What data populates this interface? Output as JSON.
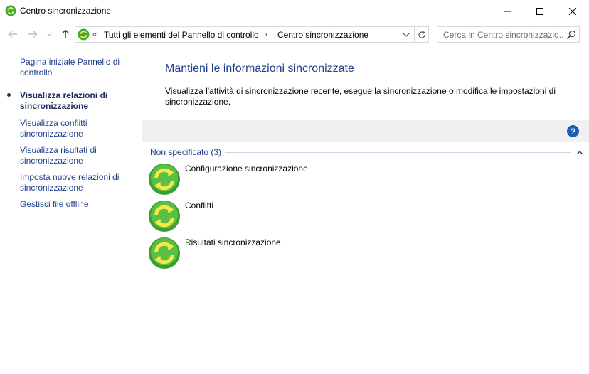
{
  "window": {
    "title": "Centro sincronizzazione",
    "minimize_icon": "minimize-icon",
    "maximize_icon": "maximize-icon",
    "close_icon": "close-icon"
  },
  "navigation": {
    "address_chevron": "«",
    "breadcrumbs": [
      "Tutti gli elementi del Pannello di controllo",
      "Centro sincronizzazione"
    ],
    "breadcrumb_separator": "›",
    "search": {
      "placeholder": "Cerca in Centro sincronizzazio..."
    }
  },
  "sidebar": {
    "items": [
      {
        "label": "Pagina iniziale Pannello di controllo",
        "active": false
      },
      {
        "label": "Visualizza relazioni di sincronizzazione",
        "active": true
      },
      {
        "label": "Visualizza conflitti sincronizzazione",
        "active": false
      },
      {
        "label": "Visualizza risultati di sincronizzazione",
        "active": false
      },
      {
        "label": "Imposta nuove relazioni di sincronizzazione",
        "active": false
      },
      {
        "label": "Gestisci file offline",
        "active": false
      }
    ]
  },
  "main": {
    "heading": "Mantieni le informazioni sincronizzate",
    "description": "Visualizza l'attività di sincronizzazione recente, esegue la sincronizzazione o modifica le impostazioni di sincronizzazione.",
    "help_label": "?",
    "group": {
      "header": "Non specificato (3)",
      "items": [
        {
          "label": "Configurazione sincronizzazione",
          "icon": "sync-icon"
        },
        {
          "label": "Conflitti",
          "icon": "sync-icon"
        },
        {
          "label": "Risultati sincronizzazione",
          "icon": "sync-icon"
        }
      ]
    }
  },
  "colors": {
    "link": "#1f3f8c",
    "heading": "#1e3f8a",
    "sync_green": "#3faa3a",
    "sync_arrow": "#f5e84a",
    "help_blue": "#1a5fb4"
  }
}
